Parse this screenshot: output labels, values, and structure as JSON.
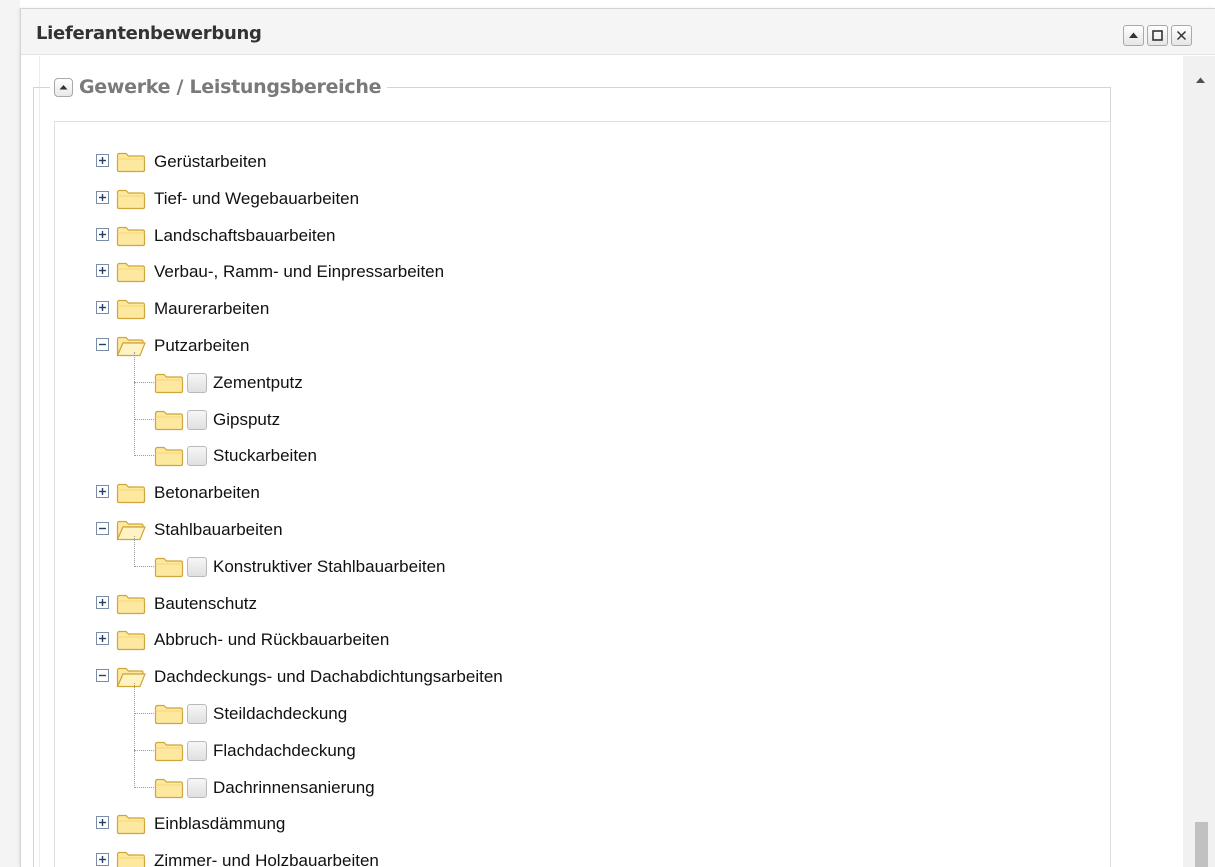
{
  "window": {
    "title": "Lieferantenbewerbung",
    "buttons": [
      "collapse",
      "maximize",
      "close"
    ]
  },
  "fieldset": {
    "legend": "Gewerke / Leistungsbereiche"
  },
  "icons": {
    "collapsed_node": "plus-box-icon",
    "expanded_node": "minus-box-icon",
    "folder_closed": "folder-closed-icon",
    "folder_open": "folder-open-icon",
    "checkbox": "checkbox-icon"
  },
  "colors": {
    "folder_fill": "#fde8a0",
    "folder_border": "#d0a53a",
    "legend_text": "#7a7a7a",
    "title_text": "#333333"
  },
  "tree": [
    {
      "label": "Gerüstarbeiten",
      "expanded": false,
      "children": []
    },
    {
      "label": "Tief- und Wegebauarbeiten",
      "expanded": false,
      "children": []
    },
    {
      "label": "Landschaftsbauarbeiten",
      "expanded": false,
      "children": []
    },
    {
      "label": "Verbau-, Ramm- und Einpressarbeiten",
      "expanded": false,
      "children": []
    },
    {
      "label": "Maurerarbeiten",
      "expanded": false,
      "children": []
    },
    {
      "label": "Putzarbeiten",
      "expanded": true,
      "children": [
        {
          "label": "Zementputz",
          "checked": false
        },
        {
          "label": "Gipsputz",
          "checked": false
        },
        {
          "label": "Stuckarbeiten",
          "checked": false
        }
      ]
    },
    {
      "label": "Betonarbeiten",
      "expanded": false,
      "children": []
    },
    {
      "label": "Stahlbauarbeiten",
      "expanded": true,
      "children": [
        {
          "label": "Konstruktiver Stahlbauarbeiten",
          "checked": false
        }
      ]
    },
    {
      "label": "Bautenschutz",
      "expanded": false,
      "children": []
    },
    {
      "label": "Abbruch- und Rückbauarbeiten",
      "expanded": false,
      "children": []
    },
    {
      "label": "Dachdeckungs- und Dachabdichtungsarbeiten",
      "expanded": true,
      "children": [
        {
          "label": "Steildachdeckung",
          "checked": false
        },
        {
          "label": "Flachdachdeckung",
          "checked": false
        },
        {
          "label": "Dachrinnensanierung",
          "checked": false
        }
      ]
    },
    {
      "label": "Einblasdämmung",
      "expanded": false,
      "children": []
    },
    {
      "label": "Zimmer- und Holzbauarbeiten",
      "expanded": false,
      "children": []
    }
  ]
}
